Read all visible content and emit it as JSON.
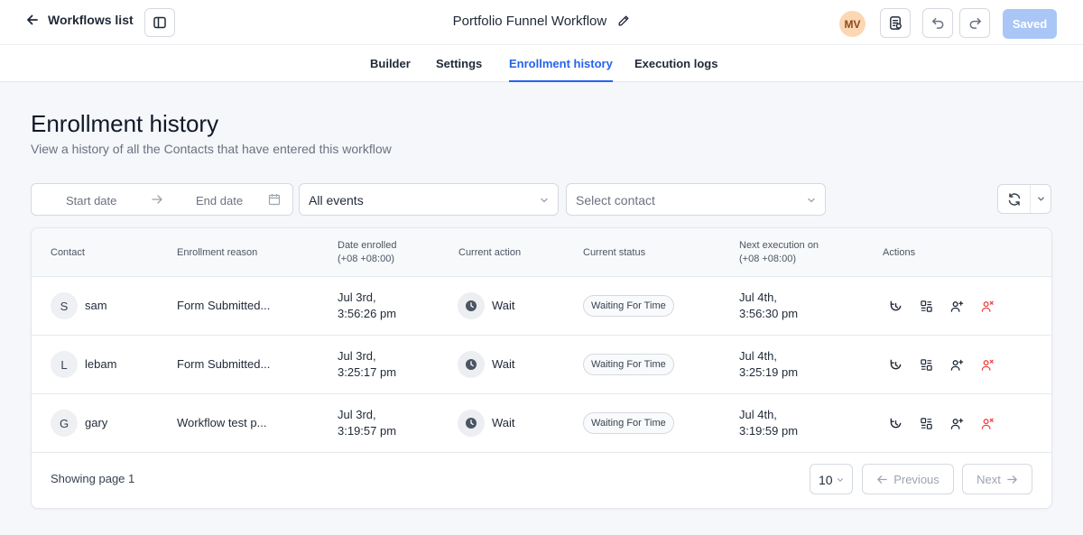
{
  "header": {
    "back_label": "Workflows list",
    "workflow_title": "Portfolio Funnel Workflow",
    "user_initials": "MV",
    "saved_label": "Saved"
  },
  "tabs": [
    {
      "label": "Builder",
      "active": false
    },
    {
      "label": "Settings",
      "active": false
    },
    {
      "label": "Enrollment history",
      "active": true
    },
    {
      "label": "Execution logs",
      "active": false
    }
  ],
  "page": {
    "title": "Enrollment history",
    "subtitle": "View a history of all the Contacts that have entered this workflow"
  },
  "filters": {
    "start_date_placeholder": "Start date",
    "end_date_placeholder": "End date",
    "events_value": "All events",
    "contact_placeholder": "Select contact"
  },
  "table": {
    "columns": {
      "contact": "Contact",
      "reason": "Enrollment reason",
      "enrolled_line1": "Date enrolled",
      "enrolled_line2": "(+08 +08:00)",
      "action": "Current action",
      "status": "Current status",
      "next_line1": "Next execution on",
      "next_line2": "(+08 +08:00)",
      "actions": "Actions"
    },
    "rows": [
      {
        "initial": "S",
        "name": "sam",
        "reason": "Form Submitted...",
        "enrolled_date": "Jul 3rd,",
        "enrolled_time": "3:56:26 pm",
        "action": "Wait",
        "status": "Waiting For Time",
        "next_date": "Jul 4th,",
        "next_time": "3:56:30 pm"
      },
      {
        "initial": "L",
        "name": "lebam",
        "reason": "Form Submitted...",
        "enrolled_date": "Jul 3rd,",
        "enrolled_time": "3:25:17 pm",
        "action": "Wait",
        "status": "Waiting For Time",
        "next_date": "Jul 4th,",
        "next_time": "3:25:19 pm"
      },
      {
        "initial": "G",
        "name": "gary",
        "reason": "Workflow test p...",
        "enrolled_date": "Jul 3rd,",
        "enrolled_time": "3:19:57 pm",
        "action": "Wait",
        "status": "Waiting For Time",
        "next_date": "Jul 4th,",
        "next_time": "3:19:59 pm"
      }
    ],
    "row_action_icons": [
      "history-icon",
      "view-details-icon",
      "add-contact-icon",
      "remove-contact-icon"
    ]
  },
  "pagination": {
    "showing_text": "Showing page 1",
    "page_size": "10",
    "previous_label": "Previous",
    "next_label": "Next"
  },
  "colors": {
    "accent": "#2563eb",
    "saved_button": "#a9c6f7",
    "remove_icon": "#ef4444",
    "avatar_bg": "#fbd7b3"
  }
}
